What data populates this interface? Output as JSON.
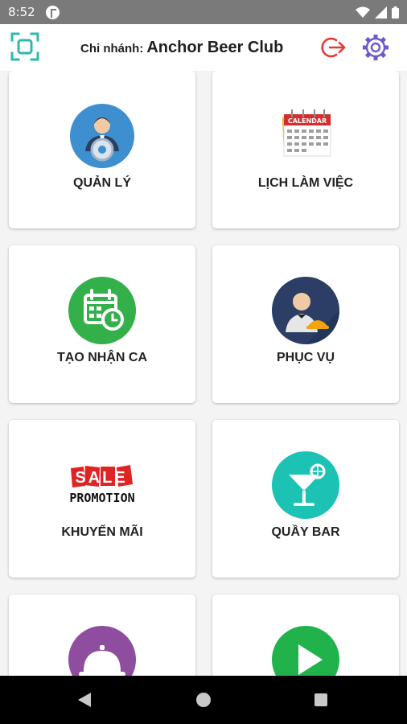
{
  "status_bar": {
    "time": "8:52"
  },
  "header": {
    "branch_label": "Chi nhánh:",
    "branch_name": "Anchor Beer Club",
    "colors": {
      "scan": "#2bbbad",
      "logout": "#e53935",
      "settings": "#6a5acd"
    }
  },
  "tiles": [
    {
      "label": "QUẢN LÝ",
      "icon": "manager-gear-icon"
    },
    {
      "label": "LỊCH LÀM VIỆC",
      "icon": "calendar-icon"
    },
    {
      "label": "TẠO NHẬN CA",
      "icon": "shift-calendar-clock-icon"
    },
    {
      "label": "PHỤC VỤ",
      "icon": "waiter-icon"
    },
    {
      "label": "KHUYẾN MÃI",
      "icon": "sale-promotion-icon",
      "icon_text": [
        "SALE",
        "PROMOTION"
      ]
    },
    {
      "label": "QUẦY BAR",
      "icon": "cocktail-icon"
    },
    {
      "label": "",
      "icon": "service-bell-icon"
    },
    {
      "label": "",
      "icon": "play-icon"
    }
  ],
  "calendar_icon_text": "CALENDAR",
  "icon_colors": {
    "manager": "#3d8fd0",
    "calendar_red": "#d32f2f",
    "shift": "#34b04a",
    "waiter": "#2c3e66",
    "sale_red": "#e02424",
    "bar": "#1cc3b4",
    "bell": "#8e4d9e",
    "play": "#22b24c"
  }
}
